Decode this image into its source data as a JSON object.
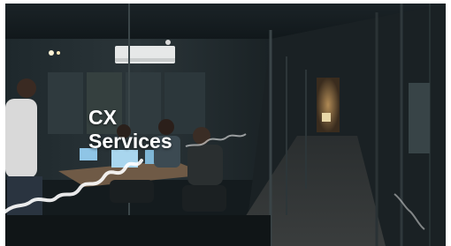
{
  "hero": {
    "title_line1": "CX",
    "title_line2": "Services",
    "image": "office-meeting-room-photo",
    "wave_icon": "white-wave-line-icon"
  }
}
